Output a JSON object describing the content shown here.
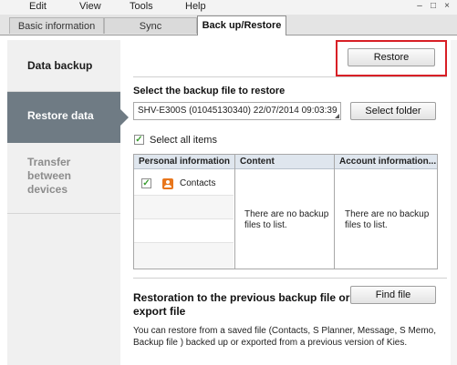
{
  "menu": {
    "items": [
      "Edit",
      "View",
      "Tools",
      "Help"
    ]
  },
  "tabs": [
    {
      "label": "Basic information"
    },
    {
      "label": "Sync"
    },
    {
      "label": "Back up/Restore"
    }
  ],
  "nav": {
    "items": [
      {
        "label_lines": [
          "Data backup"
        ]
      },
      {
        "label_lines": [
          "Restore data"
        ]
      },
      {
        "label_lines": [
          "Transfer",
          "between",
          "devices"
        ]
      }
    ]
  },
  "main": {
    "restore_label": "Restore",
    "select_label": "Select the backup file to restore",
    "backup_file_value": "SHV-E300S  (01045130340)  22/07/2014 09:03:39",
    "select_folder_label": "Select folder",
    "select_all_label": "Select all items",
    "table": {
      "columns": [
        "Personal information",
        "Content",
        "Account information..."
      ],
      "items": [
        {
          "label": "Contacts",
          "checked": true
        }
      ],
      "empty_message": "There are no backup files to list."
    },
    "restore_prev": {
      "title_lines": [
        "Restoration to the previous backup file or",
        "export file"
      ],
      "find_file_label": "Find file",
      "description": "You can restore from a saved file (Contacts, S Planner, Message, S Memo, Backup file ) backed up or exported from a previous version of Kies."
    }
  },
  "colors": {
    "highlight": "#d81f26",
    "nav_active": "#6f7b84",
    "check": "#3a9c2f",
    "contacts_icon": "#e8761c"
  }
}
